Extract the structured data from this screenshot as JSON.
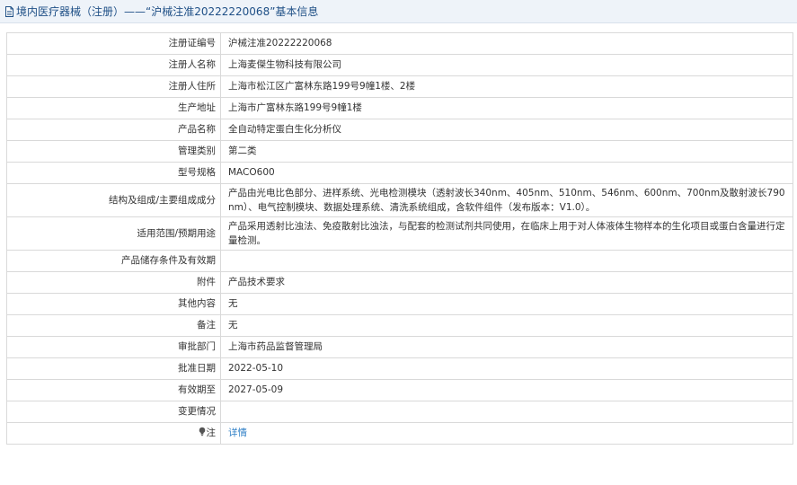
{
  "header": {
    "title": "境内医疗器械（注册）——“沪械注准20222220068”基本信息",
    "icon": "document-icon"
  },
  "rows": [
    {
      "label": "注册证编号",
      "value": "沪械注准20222220068"
    },
    {
      "label": "注册人名称",
      "value": "上海麦傑生物科技有限公司"
    },
    {
      "label": "注册人住所",
      "value": "上海市松江区广富林东路199号9幢1楼、2楼"
    },
    {
      "label": "生产地址",
      "value": "上海市广富林东路199号9幢1楼"
    },
    {
      "label": "产品名称",
      "value": "全自动特定蛋白生化分析仪"
    },
    {
      "label": "管理类别",
      "value": "第二类"
    },
    {
      "label": "型号规格",
      "value": "MACO600"
    },
    {
      "label": "结构及组成/主要组成成分",
      "value": "产品由光电比色部分、进样系统、光电检测模块（透射波长340nm、405nm、510nm、546nm、600nm、700nm及散射波长790nm）、电气控制模块、数据处理系统、清洗系统组成，含软件组件（发布版本：V1.0）。"
    },
    {
      "label": "适用范围/预期用途",
      "value": "产品采用透射比浊法、免疫散射比浊法，与配套的检测试剂共同使用，在临床上用于对人体液体生物样本的生化项目或蛋白含量进行定量检测。"
    },
    {
      "label": "产品储存条件及有效期",
      "value": ""
    },
    {
      "label": "附件",
      "value": "产品技术要求"
    },
    {
      "label": "其他内容",
      "value": "无"
    },
    {
      "label": "备注",
      "value": "无"
    },
    {
      "label": "审批部门",
      "value": "上海市药品监督管理局"
    },
    {
      "label": "批准日期",
      "value": "2022-05-10"
    },
    {
      "label": "有效期至",
      "value": "2027-05-09"
    },
    {
      "label": "变更情况",
      "value": ""
    }
  ],
  "note": {
    "label": "注",
    "icon": "lightbulb-icon",
    "link_text": "详情"
  },
  "colors": {
    "header_bg": "#eef3f9",
    "header_text": "#1e4f86",
    "border": "#d9d9d9",
    "link": "#2f7fc6"
  }
}
